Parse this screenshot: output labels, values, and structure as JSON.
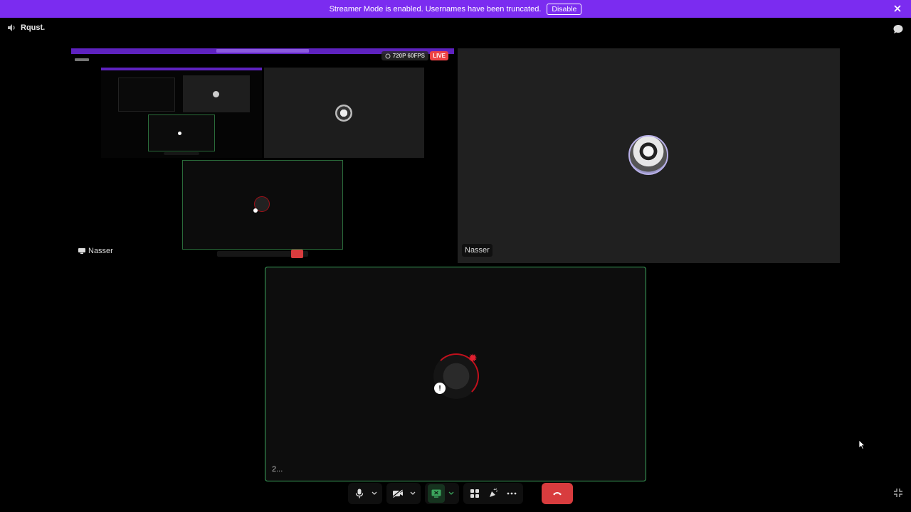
{
  "banner": {
    "message": "Streamer Mode is enabled. Usernames have been truncated.",
    "button_label": "Disable"
  },
  "channel": {
    "name": "Rqust."
  },
  "stream_tile": {
    "user_label": "Nasser",
    "quality": "720P 60FPS",
    "live_label": "LIVE"
  },
  "nasser_tile": {
    "user_label": "Nasser"
  },
  "self_tile": {
    "user_label": "2..."
  },
  "colors": {
    "banner": "#7b2cf0",
    "speaking_border": "#3ba55c",
    "hangup": "#d83c3e",
    "live": "#ed4245"
  },
  "controls": {
    "icons": [
      "microphone-icon",
      "chevron-down-icon",
      "camera-off-icon",
      "chevron-down-icon",
      "screen-share-icon",
      "chevron-down-icon",
      "activities-icon",
      "soundboard-icon",
      "more-icon",
      "hangup-icon"
    ]
  }
}
